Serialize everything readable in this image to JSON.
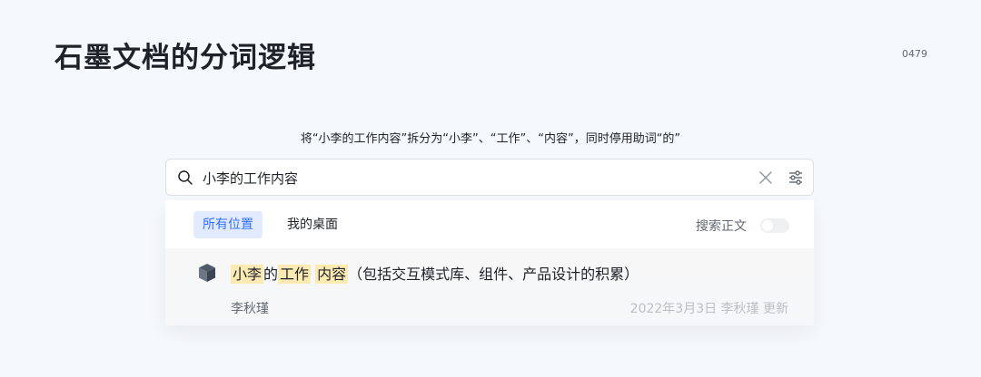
{
  "page": {
    "title": "石墨文档的分词逻辑",
    "number": "0479",
    "caption": "将“小李的工作内容”拆分为“小李”、“工作”、“内容”，同时停用助词“的”"
  },
  "search": {
    "query": "小李的工作内容",
    "icons": {
      "search": "search-icon",
      "clear": "close-icon",
      "filter": "sliders-icon"
    }
  },
  "filters": {
    "tabs": [
      {
        "label": "所有位置",
        "selected": true
      },
      {
        "label": "我的桌面",
        "selected": false
      }
    ],
    "fulltext_label": "搜索正文",
    "fulltext_enabled": false
  },
  "result": {
    "icon": "cube-icon",
    "title_parts": {
      "hl1": "小李",
      "t1": "的",
      "hl2": "工作",
      "hl3": "内容",
      "rest": "（包括交互模式库、组件、产品设计的积累）"
    },
    "owner": "李秋瑾",
    "meta": "2022年3月3日 李秋瑾 更新"
  },
  "colors": {
    "accent": "#3370ff",
    "highlight": "#fdeab2",
    "background": "#f5f8fc"
  }
}
